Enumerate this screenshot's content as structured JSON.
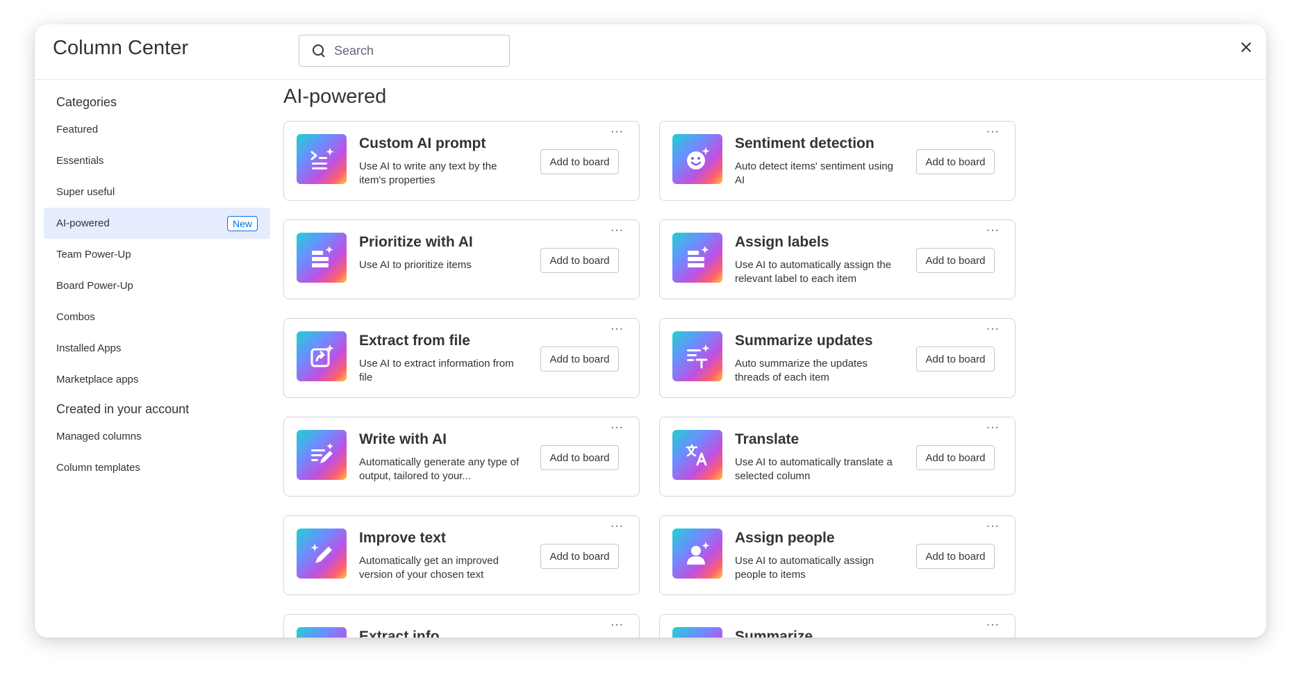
{
  "header": {
    "title": "Column Center",
    "search_placeholder": "Search"
  },
  "sidebar": {
    "categories_heading": "Categories",
    "items": [
      {
        "label": "Featured"
      },
      {
        "label": "Essentials"
      },
      {
        "label": "Super useful"
      },
      {
        "label": "AI-powered",
        "badge": "New",
        "active": true
      },
      {
        "label": "Team Power-Up"
      },
      {
        "label": "Board Power-Up"
      },
      {
        "label": "Combos"
      },
      {
        "label": "Installed Apps"
      },
      {
        "label": "Marketplace apps"
      }
    ],
    "created_heading": "Created in your account",
    "created_items": [
      {
        "label": "Managed columns"
      },
      {
        "label": "Column templates"
      }
    ]
  },
  "main": {
    "section_title": "AI-powered",
    "add_label": "Add to board",
    "more_label": "···",
    "cards": [
      {
        "name": "Custom AI prompt",
        "desc": "Use AI to write any text by the item's properties",
        "icon": "prompt-icon"
      },
      {
        "name": "Sentiment detection",
        "desc": "Auto detect items' sentiment using AI",
        "icon": "smiley-icon"
      },
      {
        "name": "Prioritize with AI",
        "desc": "Use AI to prioritize items",
        "icon": "priority-icon"
      },
      {
        "name": "Assign labels",
        "desc": "Use AI to automatically assign the relevant label to each item",
        "icon": "label-icon"
      },
      {
        "name": "Extract from file",
        "desc": "Use AI to extract information from file",
        "icon": "file-extract-icon"
      },
      {
        "name": "Summarize updates",
        "desc": "Auto summarize the updates threads of each item",
        "icon": "summarize-icon"
      },
      {
        "name": "Write with AI",
        "desc": "Automatically generate any type of output, tailored to your...",
        "icon": "write-icon"
      },
      {
        "name": "Translate",
        "desc": "Use AI to automatically translate a selected column",
        "icon": "translate-icon"
      },
      {
        "name": "Improve text",
        "desc": "Automatically get an improved version of your chosen text",
        "icon": "pencil-icon"
      },
      {
        "name": "Assign people",
        "desc": "Use AI to automatically assign people to items",
        "icon": "person-icon"
      },
      {
        "name": "Extract info",
        "desc": "",
        "icon": "extract-icon"
      },
      {
        "name": "Summarize",
        "desc": "",
        "icon": "summarize-icon"
      }
    ]
  }
}
